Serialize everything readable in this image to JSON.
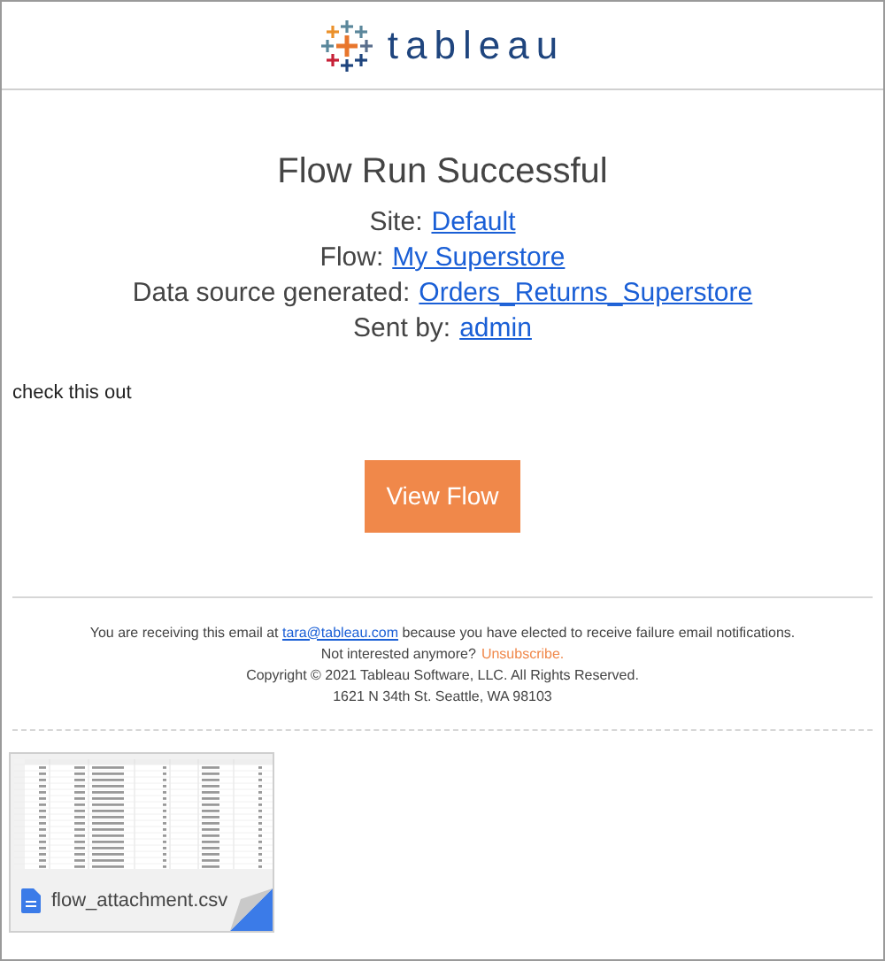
{
  "logo": {
    "text": "tableau"
  },
  "title": "Flow Run Successful",
  "details": [
    {
      "label": "Site:",
      "value": "Default"
    },
    {
      "label": "Flow:",
      "value": "My Superstore"
    },
    {
      "label": "Data source generated:",
      "value": "Orders_Returns_Superstore"
    },
    {
      "label": "Sent by:",
      "value": "admin"
    }
  ],
  "message": "check this out",
  "button": "View Flow",
  "footer": {
    "notice_before": "You are receiving this email at",
    "email": "tara@tableau.com",
    "notice_after": "because you have elected to receive failure email notifications.",
    "unsubscribe_prompt": "Not interested anymore?",
    "unsubscribe": "Unsubscribe.",
    "copyright": "Copyright © 2021 Tableau Software, LLC. All Rights Reserved.",
    "address": "1621 N 34th St. Seattle, WA 98103"
  },
  "attachment": {
    "filename": "flow_attachment.csv"
  }
}
